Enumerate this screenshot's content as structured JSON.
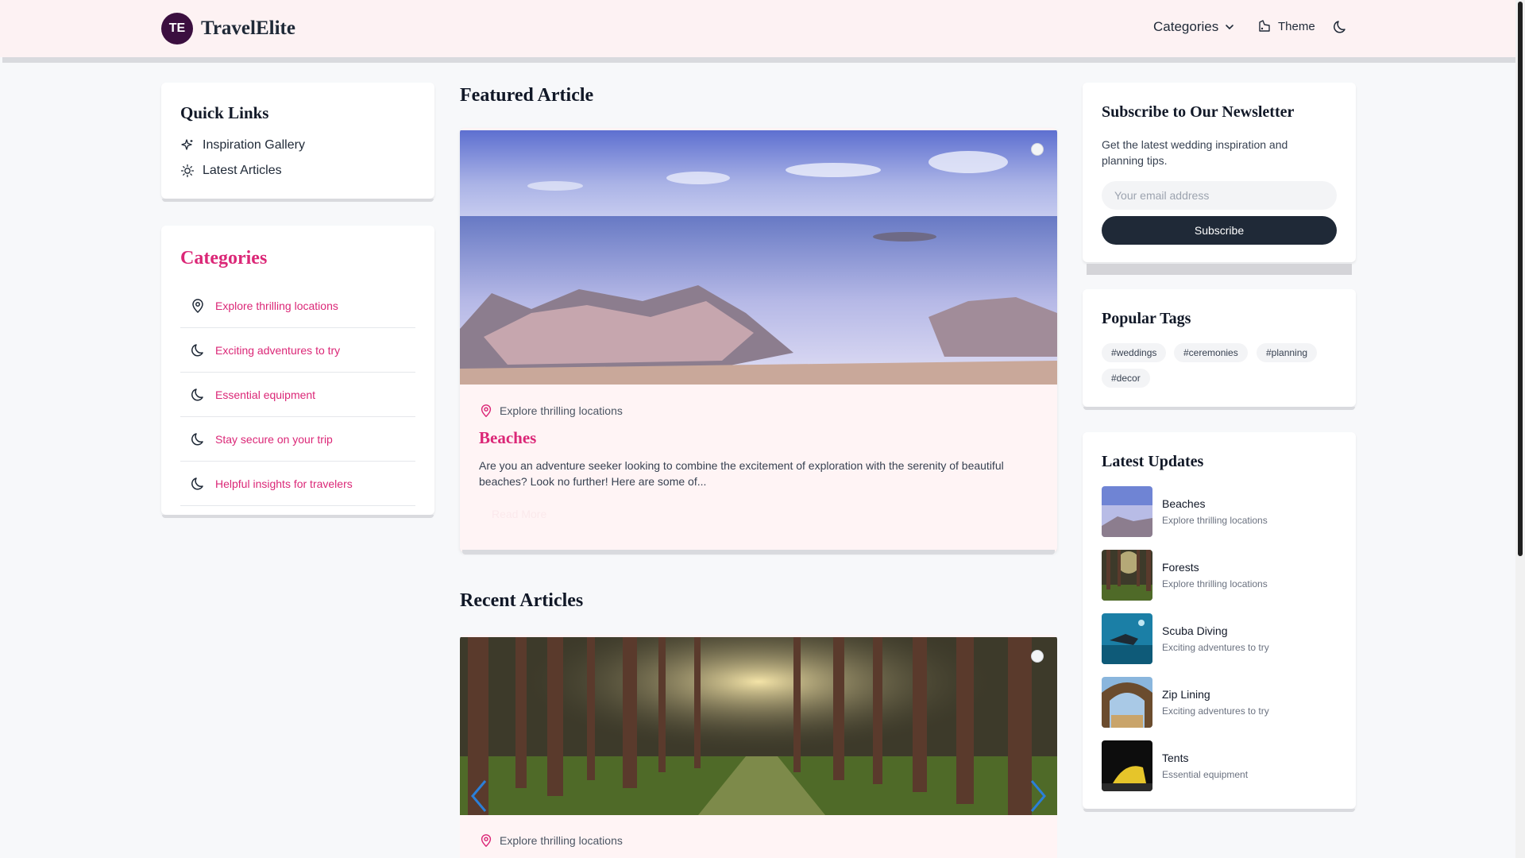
{
  "brand": {
    "initials": "TE",
    "name": "TravelElite"
  },
  "nav": {
    "categories_label": "Categories",
    "theme_label": "Theme"
  },
  "quick_links": {
    "title": "Quick Links",
    "items": [
      {
        "label": "Inspiration Gallery",
        "icon": "sparkles-icon"
      },
      {
        "label": "Latest Articles",
        "icon": "sun-icon"
      }
    ]
  },
  "categories": {
    "title": "Categories",
    "items": [
      {
        "label": "Explore thrilling locations",
        "icon": "map-pin-icon"
      },
      {
        "label": "Exciting adventures to try",
        "icon": "moon-icon"
      },
      {
        "label": "Essential equipment",
        "icon": "moon-icon"
      },
      {
        "label": "Stay secure on your trip",
        "icon": "moon-icon"
      },
      {
        "label": "Helpful insights for travelers",
        "icon": "moon-icon"
      }
    ]
  },
  "featured": {
    "heading": "Featured Article",
    "category": "Explore thrilling locations",
    "title": "Beaches",
    "excerpt": "Are you an adventure seeker looking to combine the excitement of exploration with the serenity of beautiful beaches? Look no further! Here are some of...",
    "read_more": "Read More"
  },
  "recent": {
    "heading": "Recent Articles",
    "category": "Explore thrilling locations"
  },
  "newsletter": {
    "title": "Subscribe to Our Newsletter",
    "description": "Get the latest wedding inspiration and planning tips.",
    "placeholder": "Your email address",
    "button": "Subscribe"
  },
  "tags": {
    "title": "Popular Tags",
    "items": [
      "#weddings",
      "#ceremonies",
      "#planning",
      "#decor"
    ]
  },
  "latest_updates": {
    "title": "Latest Updates",
    "items": [
      {
        "title": "Beaches",
        "category": "Explore thrilling locations"
      },
      {
        "title": "Forests",
        "category": "Explore thrilling locations"
      },
      {
        "title": "Scuba Diving",
        "category": "Exciting adventures to try"
      },
      {
        "title": "Zip Lining",
        "category": "Exciting adventures to try"
      },
      {
        "title": "Tents",
        "category": "Essential equipment"
      }
    ]
  },
  "colors": {
    "accent": "#db2777",
    "dark": "#1f2937",
    "header_bg": "#fdf2f3"
  }
}
